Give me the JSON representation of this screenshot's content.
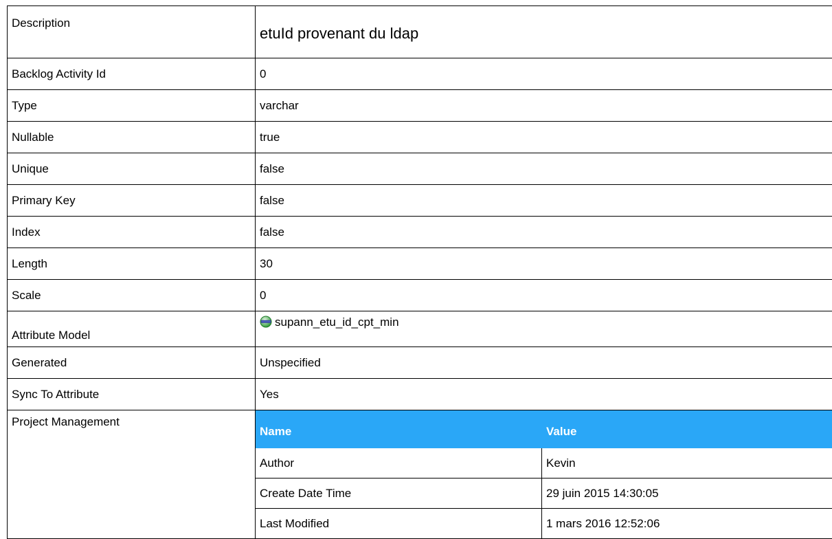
{
  "rows": [
    {
      "label": "Description",
      "value": "etuId provenant du ldap"
    },
    {
      "label": "Backlog Activity Id",
      "value": "0"
    },
    {
      "label": "Type",
      "value": "varchar"
    },
    {
      "label": "Nullable",
      "value": "true"
    },
    {
      "label": "Unique",
      "value": "false"
    },
    {
      "label": "Primary Key",
      "value": "false"
    },
    {
      "label": "Index",
      "value": "false"
    },
    {
      "label": "Length",
      "value": "30"
    },
    {
      "label": "Scale",
      "value": "0"
    },
    {
      "label": "Attribute Model",
      "value": "supann_etu_id_cpt_min",
      "icon": "attribute-model-icon"
    },
    {
      "label": "Generated",
      "value": "Unspecified"
    },
    {
      "label": "Sync To Attribute",
      "value": "Yes"
    },
    {
      "label": "Project Management"
    }
  ],
  "project_management": {
    "headers": [
      "Name",
      "Value"
    ],
    "rows": [
      [
        "Author",
        "Kevin"
      ],
      [
        "Create Date Time",
        "29 juin 2015 14:30:05"
      ],
      [
        "Last Modified",
        "1 mars 2016 12:52:06"
      ]
    ],
    "header_color": "#2aa7f7"
  }
}
